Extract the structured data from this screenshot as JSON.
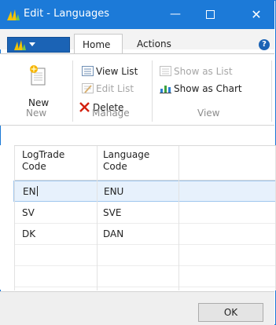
{
  "window": {
    "title": "Edit - Languages",
    "colors": {
      "titlebar": "#1c7ad8",
      "app_menu": "#1b63b5",
      "selection": "#e7f1fc"
    }
  },
  "tabs": [
    {
      "label": "Home",
      "active": true
    },
    {
      "label": "Actions",
      "active": false
    }
  ],
  "ribbon": {
    "groups": [
      {
        "label": "New",
        "items": [
          {
            "label": "New",
            "icon": "new-document-icon",
            "enabled": true
          }
        ]
      },
      {
        "label": "Manage",
        "items": [
          {
            "label": "View List",
            "icon": "view-list-icon",
            "enabled": true
          },
          {
            "label": "Edit List",
            "icon": "edit-list-icon",
            "enabled": false
          },
          {
            "label": "Delete",
            "icon": "delete-x-icon",
            "enabled": true
          }
        ]
      },
      {
        "label": "View",
        "items": [
          {
            "label": "Show as List",
            "icon": "show-as-list-icon",
            "enabled": false
          },
          {
            "label": "Show as Chart",
            "icon": "show-as-chart-icon",
            "enabled": true
          }
        ]
      }
    ]
  },
  "grid": {
    "columns": [
      {
        "header": "LogTrade\nCode"
      },
      {
        "header": "Language\nCode"
      }
    ],
    "rows": [
      {
        "cells": [
          "EN",
          "ENU"
        ],
        "selected": true
      },
      {
        "cells": [
          "SV",
          "SVE"
        ],
        "selected": false
      },
      {
        "cells": [
          "DK",
          "DAN"
        ],
        "selected": false
      }
    ]
  },
  "footer": {
    "ok_label": "OK"
  }
}
